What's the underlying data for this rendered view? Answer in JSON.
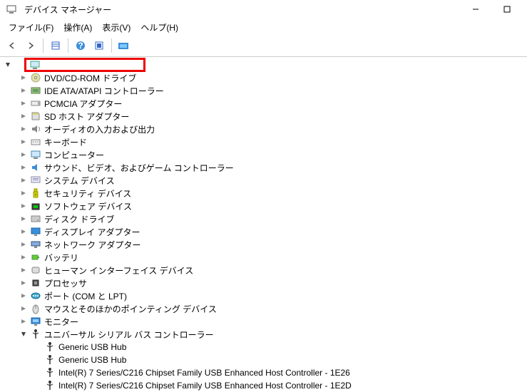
{
  "window": {
    "title": "デバイス マネージャー",
    "minimize": "—",
    "maximize": "▢",
    "close": "✕"
  },
  "menu": {
    "file": "ファイル(F)",
    "action": "操作(A)",
    "view": "表示(V)",
    "help": "ヘルプ(H)"
  },
  "toolbar": {
    "back": "back",
    "forward": "forward",
    "properties": "properties",
    "help": "help",
    "refresh": "refresh",
    "scan": "scan"
  },
  "root_label": "",
  "categories": [
    {
      "label": "DVD/CD-ROM ドライブ",
      "icon": "cd"
    },
    {
      "label": "IDE ATA/ATAPI コントローラー",
      "icon": "ide"
    },
    {
      "label": "PCMCIA アダプター",
      "icon": "pcmcia"
    },
    {
      "label": "SD ホスト アダプター",
      "icon": "sd"
    },
    {
      "label": "オーディオの入力および出力",
      "icon": "audio"
    },
    {
      "label": "キーボード",
      "icon": "kbd"
    },
    {
      "label": "コンピューター",
      "icon": "computer"
    },
    {
      "label": "サウンド、ビデオ、およびゲーム コントローラー",
      "icon": "sound"
    },
    {
      "label": "システム デバイス",
      "icon": "system"
    },
    {
      "label": "セキュリティ デバイス",
      "icon": "security"
    },
    {
      "label": "ソフトウェア デバイス",
      "icon": "software"
    },
    {
      "label": "ディスク ドライブ",
      "icon": "disk"
    },
    {
      "label": "ディスプレイ アダプター",
      "icon": "display"
    },
    {
      "label": "ネットワーク アダプター",
      "icon": "network"
    },
    {
      "label": "バッテリ",
      "icon": "battery"
    },
    {
      "label": "ヒューマン インターフェイス デバイス",
      "icon": "hid"
    },
    {
      "label": "プロセッサ",
      "icon": "cpu"
    },
    {
      "label": "ポート (COM と LPT)",
      "icon": "port"
    },
    {
      "label": "マウスとそのほかのポインティング デバイス",
      "icon": "mouse"
    },
    {
      "label": "モニター",
      "icon": "monitor"
    }
  ],
  "usb_category_label": "ユニバーサル シリアル バス コントローラー",
  "usb_items": [
    "Generic USB Hub",
    "Generic USB Hub",
    "Intel(R) 7 Series/C216 Chipset Family USB Enhanced Host Controller - 1E26",
    "Intel(R) 7 Series/C216 Chipset Family USB Enhanced Host Controller - 1E2D"
  ]
}
